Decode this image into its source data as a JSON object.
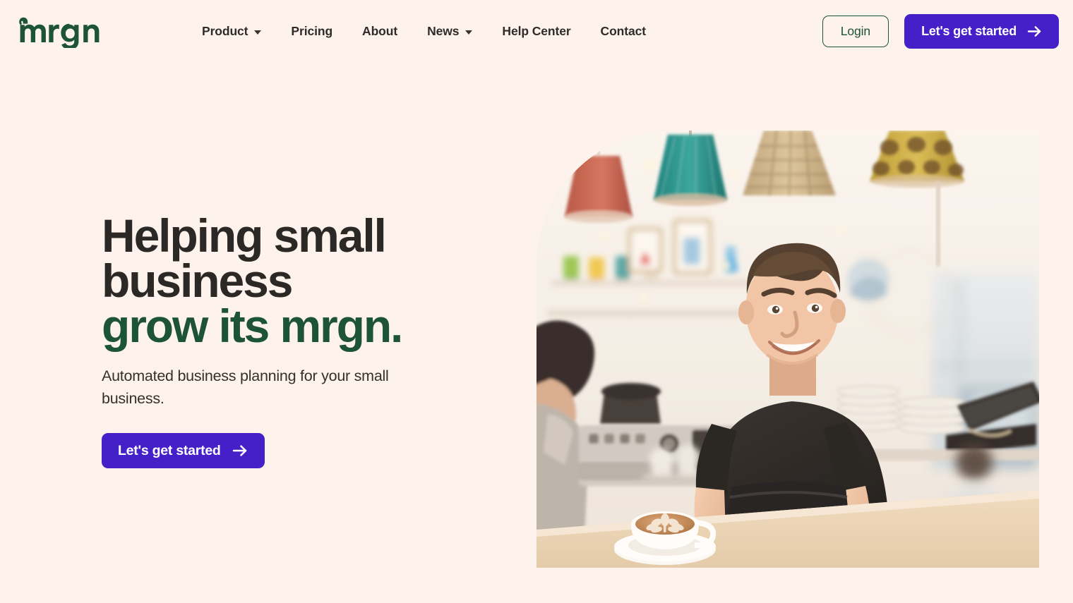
{
  "brand": {
    "name": "mrgn",
    "logo_icon": "mrgn-wordmark-logo",
    "green": "#1d5336",
    "purple": "#4520c8",
    "background": "#fdf3ec",
    "ink": "#2b2825"
  },
  "header": {
    "nav": [
      {
        "label": "Product",
        "name": "product",
        "has_dropdown": true,
        "dropdown_icon": "chevron-down-icon"
      },
      {
        "label": "Pricing",
        "name": "pricing",
        "has_dropdown": false,
        "dropdown_icon": ""
      },
      {
        "label": "About",
        "name": "about",
        "has_dropdown": false,
        "dropdown_icon": ""
      },
      {
        "label": "News",
        "name": "news",
        "has_dropdown": true,
        "dropdown_icon": "chevron-down-icon"
      },
      {
        "label": "Help Center",
        "name": "help-center",
        "has_dropdown": false,
        "dropdown_icon": ""
      },
      {
        "label": "Contact",
        "name": "contact",
        "has_dropdown": false,
        "dropdown_icon": ""
      }
    ],
    "login_label": "Login",
    "cta_label": "Let's get started",
    "cta_icon": "arrow-right-icon"
  },
  "hero": {
    "headline_line1": "Helping small",
    "headline_line2": "business",
    "headline_accent": "grow its mrgn.",
    "subhead": "Automated business planning for your small business.",
    "cta_label": "Let's get started",
    "cta_icon": "arrow-right-icon",
    "image_alt": "Smiling small business owner in a black t-shirt and apron standing behind a cafe counter with a latte, while a barista works at the espresso machine behind him"
  }
}
